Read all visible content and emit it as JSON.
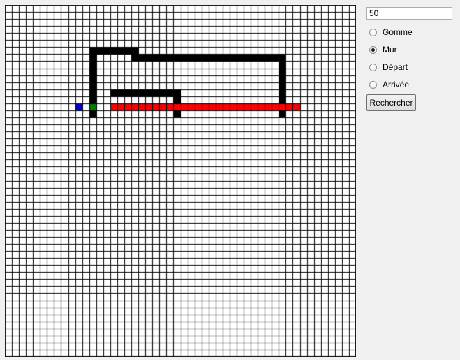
{
  "grid": {
    "cols": 50,
    "rows": 50,
    "colors": {
      "wall": "#000000",
      "path": "#ff0000",
      "start": "#0000cc",
      "end": "#008000",
      "empty": "#ffffff",
      "line": "#000000"
    },
    "walls": [
      [
        6,
        12
      ],
      [
        6,
        13
      ],
      [
        6,
        14
      ],
      [
        6,
        15
      ],
      [
        6,
        16
      ],
      [
        6,
        17
      ],
      [
        6,
        18
      ],
      [
        7,
        12
      ],
      [
        7,
        18
      ],
      [
        7,
        19
      ],
      [
        7,
        20
      ],
      [
        7,
        21
      ],
      [
        7,
        22
      ],
      [
        7,
        23
      ],
      [
        7,
        24
      ],
      [
        7,
        25
      ],
      [
        7,
        26
      ],
      [
        7,
        27
      ],
      [
        7,
        28
      ],
      [
        7,
        29
      ],
      [
        7,
        30
      ],
      [
        7,
        31
      ],
      [
        7,
        32
      ],
      [
        7,
        33
      ],
      [
        7,
        34
      ],
      [
        7,
        35
      ],
      [
        7,
        36
      ],
      [
        7,
        37
      ],
      [
        7,
        38
      ],
      [
        7,
        39
      ],
      [
        8,
        12
      ],
      [
        8,
        39
      ],
      [
        9,
        12
      ],
      [
        9,
        39
      ],
      [
        10,
        12
      ],
      [
        10,
        39
      ],
      [
        11,
        12
      ],
      [
        11,
        39
      ],
      [
        12,
        12
      ],
      [
        12,
        15
      ],
      [
        12,
        16
      ],
      [
        12,
        17
      ],
      [
        12,
        18
      ],
      [
        12,
        19
      ],
      [
        12,
        20
      ],
      [
        12,
        21
      ],
      [
        12,
        22
      ],
      [
        12,
        23
      ],
      [
        12,
        24
      ],
      [
        12,
        39
      ],
      [
        13,
        12
      ],
      [
        13,
        24
      ],
      [
        13,
        39
      ],
      [
        14,
        12
      ],
      [
        14,
        24
      ],
      [
        14,
        39
      ],
      [
        15,
        12
      ],
      [
        15,
        24
      ],
      [
        15,
        39
      ]
    ],
    "path": [
      [
        14,
        15
      ],
      [
        14,
        16
      ],
      [
        14,
        17
      ],
      [
        14,
        18
      ],
      [
        14,
        19
      ],
      [
        14,
        20
      ],
      [
        14,
        21
      ],
      [
        14,
        22
      ],
      [
        14,
        23
      ],
      [
        14,
        24
      ],
      [
        14,
        25
      ],
      [
        14,
        26
      ],
      [
        14,
        27
      ],
      [
        14,
        28
      ],
      [
        14,
        29
      ],
      [
        14,
        30
      ],
      [
        14,
        31
      ],
      [
        14,
        32
      ],
      [
        14,
        33
      ],
      [
        14,
        34
      ],
      [
        14,
        35
      ],
      [
        14,
        36
      ],
      [
        14,
        37
      ],
      [
        14,
        38
      ],
      [
        14,
        39
      ],
      [
        14,
        40
      ],
      [
        14,
        41
      ]
    ],
    "start": [
      14,
      10
    ],
    "end": [
      14,
      12
    ]
  },
  "controls": {
    "size_value": "50",
    "radios": [
      {
        "label": "Gomme",
        "checked": false
      },
      {
        "label": "Mur",
        "checked": true
      },
      {
        "label": "Départ",
        "checked": false
      },
      {
        "label": "Arrivée",
        "checked": false
      }
    ],
    "search_label": "Rechercher"
  }
}
